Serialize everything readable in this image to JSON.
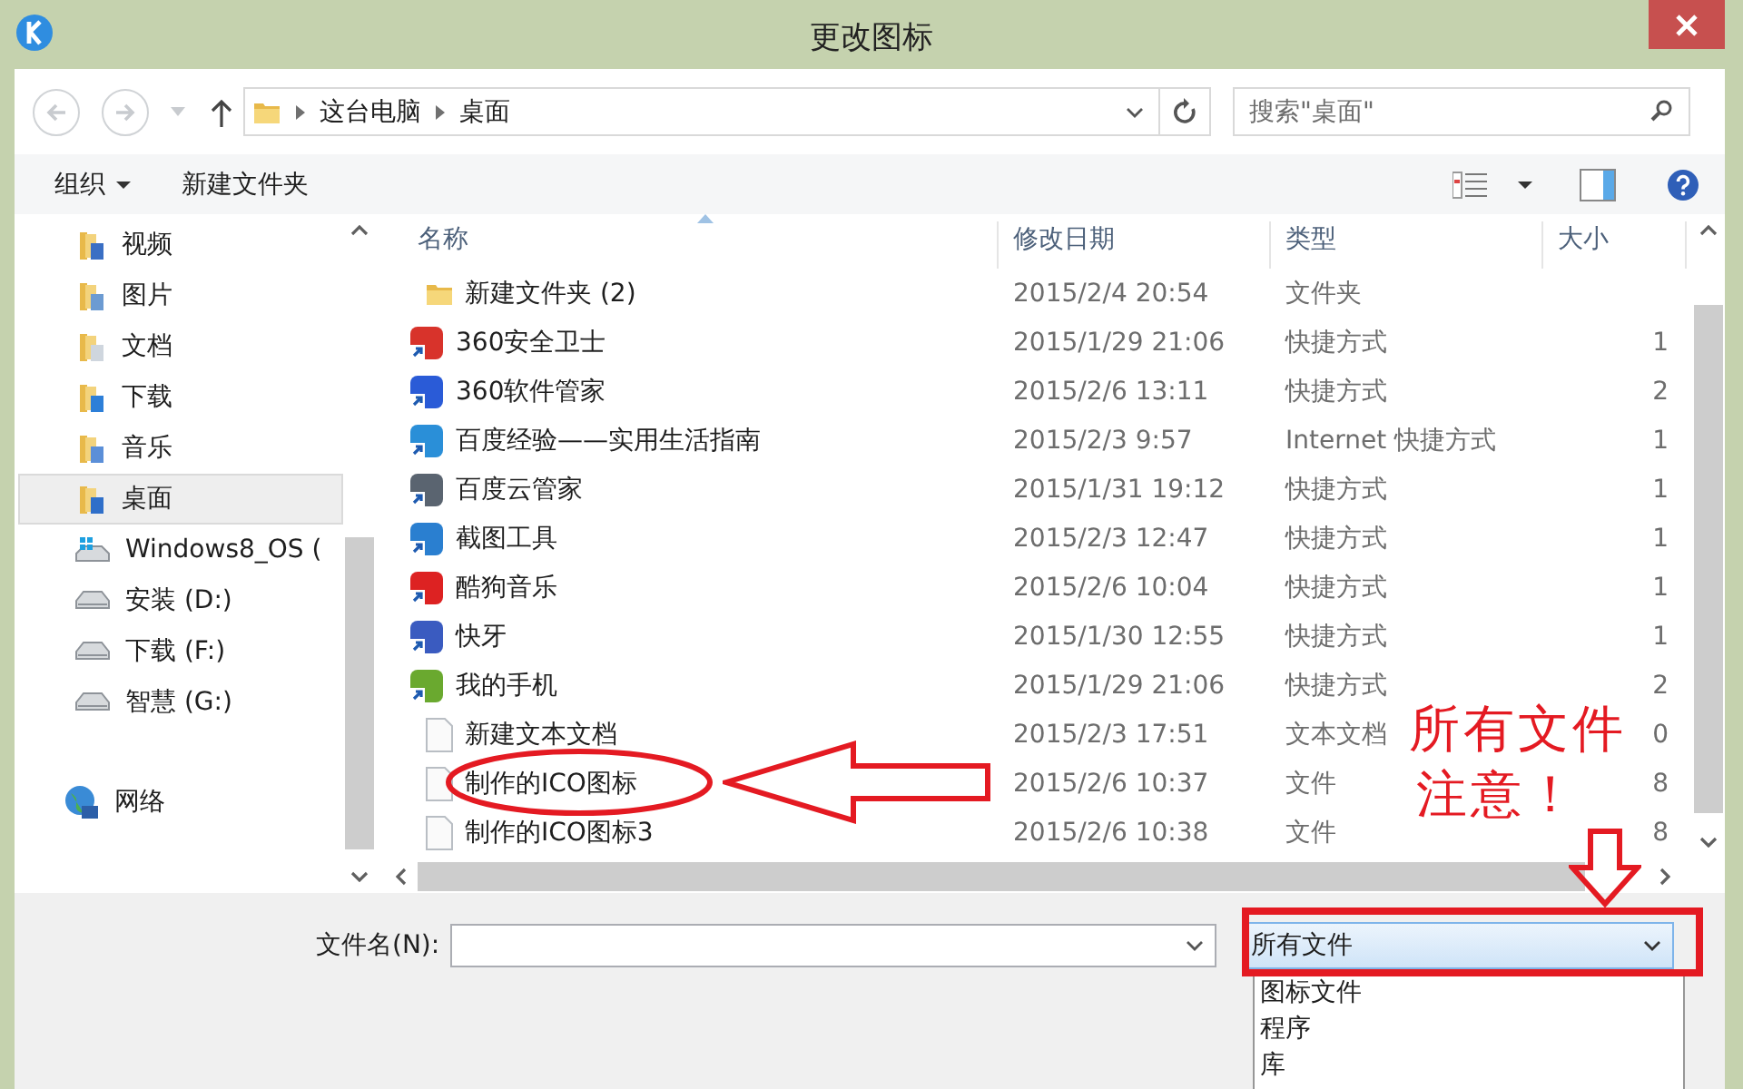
{
  "window": {
    "title": "更改图标"
  },
  "address": {
    "path": [
      "这台电脑",
      "桌面"
    ]
  },
  "search": {
    "placeholder": "搜索\"桌面\""
  },
  "toolbar": {
    "organize": "组织",
    "new_folder": "新建文件夹"
  },
  "nav_pane": [
    {
      "label": "视频",
      "kind": "library",
      "selected": false
    },
    {
      "label": "图片",
      "kind": "library",
      "selected": false
    },
    {
      "label": "文档",
      "kind": "library",
      "selected": false
    },
    {
      "label": "下载",
      "kind": "library",
      "selected": false
    },
    {
      "label": "音乐",
      "kind": "library",
      "selected": false
    },
    {
      "label": "桌面",
      "kind": "library",
      "selected": true
    },
    {
      "label": "Windows8_OS (",
      "kind": "system-drive",
      "selected": false
    },
    {
      "label": "安装 (D:)",
      "kind": "drive",
      "selected": false
    },
    {
      "label": "下载 (F:)",
      "kind": "drive",
      "selected": false
    },
    {
      "label": "智慧 (G:)",
      "kind": "drive",
      "selected": false
    },
    {
      "label": "网络",
      "kind": "network",
      "selected": false
    }
  ],
  "file_list": {
    "columns": [
      "名称",
      "修改日期",
      "类型",
      "大小"
    ],
    "rows": [
      {
        "name": "新建文件夹 (2)",
        "kind": "folder",
        "modified": "2015/2/4 20:54",
        "type": "文件夹"
      },
      {
        "name": "360安全卫士",
        "kind": "shortcut",
        "modified": "2015/1/29 21:06",
        "type": "快捷方式",
        "size": "1"
      },
      {
        "name": "360软件管家",
        "kind": "shortcut",
        "modified": "2015/2/6 13:11",
        "type": "快捷方式",
        "size": "2"
      },
      {
        "name": "百度经验——实用生活指南",
        "kind": "shortcut",
        "modified": "2015/2/3 9:57",
        "type": "Internet 快捷方式",
        "size": "1"
      },
      {
        "name": "百度云管家",
        "kind": "shortcut",
        "modified": "2015/1/31 19:12",
        "type": "快捷方式",
        "size": "1"
      },
      {
        "name": "截图工具",
        "kind": "shortcut",
        "modified": "2015/2/3 12:47",
        "type": "快捷方式",
        "size": "1"
      },
      {
        "name": "酷狗音乐",
        "kind": "shortcut",
        "modified": "2015/2/6 10:04",
        "type": "快捷方式",
        "size": "1"
      },
      {
        "name": "快牙",
        "kind": "shortcut",
        "modified": "2015/1/30 12:55",
        "type": "快捷方式",
        "size": "1"
      },
      {
        "name": "我的手机",
        "kind": "shortcut",
        "modified": "2015/1/29 21:06",
        "type": "快捷方式",
        "size": "2"
      },
      {
        "name": "新建文本文档",
        "kind": "document",
        "modified": "2015/2/3 17:51",
        "type": "文本文档",
        "size": "0"
      },
      {
        "name": "制作的ICO图标",
        "kind": "document",
        "modified": "2015/2/6 10:37",
        "type": "文件",
        "size": "8"
      },
      {
        "name": "制作的ICO图标3",
        "kind": "document",
        "modified": "2015/2/6 10:38",
        "type": "文件",
        "size": "8"
      }
    ]
  },
  "footer": {
    "file_name_label": "文件名(N):",
    "file_type": {
      "value": "所有文件",
      "options": [
        "图标文件",
        "程序",
        "库"
      ]
    }
  },
  "annotations": [
    {
      "kind": "note",
      "text": "所有文件"
    },
    {
      "kind": "note",
      "text": "注意！"
    }
  ]
}
